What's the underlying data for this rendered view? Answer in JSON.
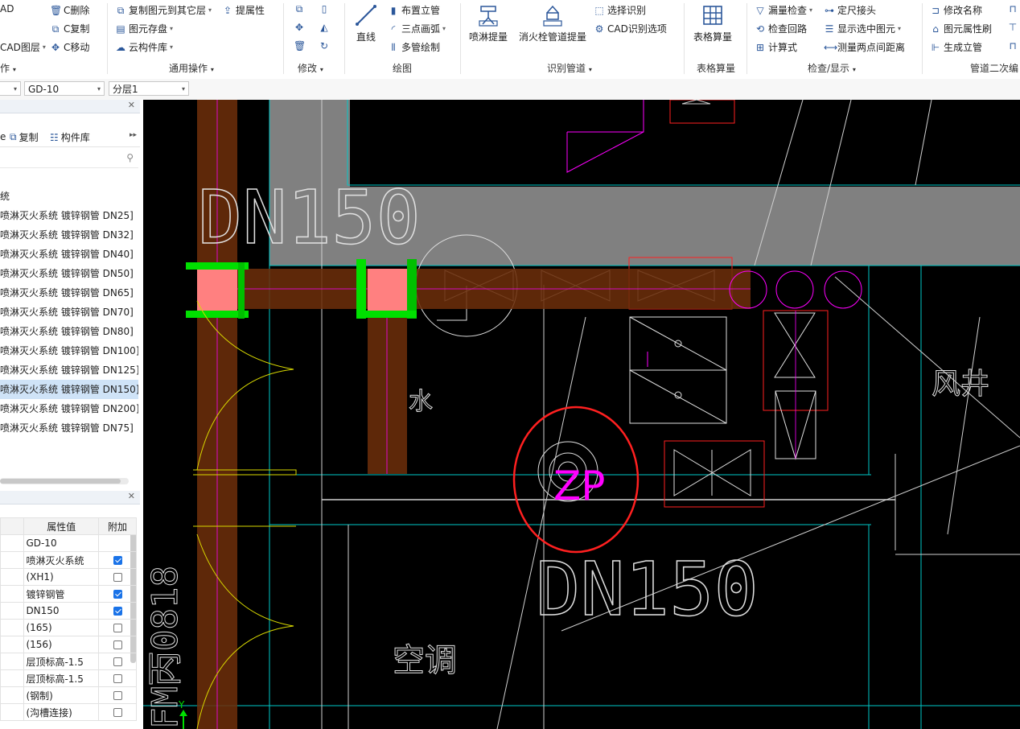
{
  "ribbon": {
    "col1": {
      "r1": "AD",
      "r3": "CAD图层"
    },
    "col2": {
      "r1": "C删除",
      "r2": "C复制",
      "r3": "C移动"
    },
    "col3": {
      "r1": "复制图元到其它层",
      "r2": "图元存盘",
      "r3": "云构件库",
      "r1b": "提属性"
    },
    "draw": {
      "line": "直线",
      "riser": "布置立管",
      "arc": "三点画弧",
      "multi": "多管绘制"
    },
    "identify": {
      "sprinkler": "喷淋提量",
      "hydrant": "消火栓管道提量",
      "select": "选择识别",
      "cad_opts": "CAD识别选项"
    },
    "table": {
      "table_calc": "表格算量"
    },
    "check": {
      "leak": "漏量检查",
      "loop": "检查回路",
      "formula": "计算式",
      "fixed": "定尺接头",
      "show_sel": "显示选中图元",
      "measure": "测量两点间距离"
    },
    "pipe2": {
      "rename": "修改名称",
      "brush": "图元属性刷",
      "gen_riser": "生成立管"
    },
    "groups": {
      "op": "作",
      "common": "通用操作",
      "modify": "修改",
      "draw": "绘图",
      "identify": "识别管道",
      "table": "表格算量",
      "check": "检查/显示",
      "pipe2": "管道二次编"
    }
  },
  "toolbar2": {
    "dd1": "",
    "dd2": "GD-10",
    "dd3": "分层1"
  },
  "left": {
    "actions": {
      "copy": "复制",
      "lib": "构件库"
    },
    "tree_head": "统",
    "tree": [
      "喷淋灭火系统 镀锌钢管 DN25]",
      "喷淋灭火系统 镀锌钢管 DN32]",
      "喷淋灭火系统 镀锌钢管 DN40]",
      "喷淋灭火系统 镀锌钢管 DN50]",
      "喷淋灭火系统 镀锌钢管 DN65]",
      "喷淋灭火系统 镀锌钢管 DN70]",
      "喷淋灭火系统 镀锌钢管 DN80]",
      "喷淋灭火系统 镀锌钢管 DN100]",
      "喷淋灭火系统 镀锌钢管 DN125]",
      "喷淋灭火系统 镀锌钢管 DN150]",
      "喷淋灭火系统 镀锌钢管 DN200]",
      "喷淋灭火系统 镀锌钢管 DN75]"
    ],
    "selected_index": 9,
    "props": {
      "header": {
        "value": "属性值",
        "extra": "附加"
      },
      "rows": [
        {
          "v": "GD-10",
          "c": null
        },
        {
          "v": "喷淋灭火系统",
          "c": true
        },
        {
          "v": "(XH1)",
          "c": false
        },
        {
          "v": "镀锌钢管",
          "c": true
        },
        {
          "v": "DN150",
          "c": true
        },
        {
          "v": "(165)",
          "c": false
        },
        {
          "v": "(156)",
          "c": false
        },
        {
          "v": "层顶标高-1.5",
          "c": false
        },
        {
          "v": "层顶标高-1.5",
          "c": false
        },
        {
          "v": "(钢制)",
          "c": false
        },
        {
          "v": "(沟槽连接)",
          "c": false
        }
      ]
    }
  },
  "canvas": {
    "dn_top": "DN150",
    "dn_bottom": "DN150",
    "zp": "ZP",
    "water": "水",
    "ac": "空调",
    "fengjing": "风井",
    "side_text": "FM丙0818",
    "axis_y": "Y",
    "colors": {
      "pipe": "#6b2e0a",
      "grip": "#00e000",
      "node": "#ff8080",
      "magenta": "#ff00ff",
      "highlight": "#ff2020"
    }
  }
}
